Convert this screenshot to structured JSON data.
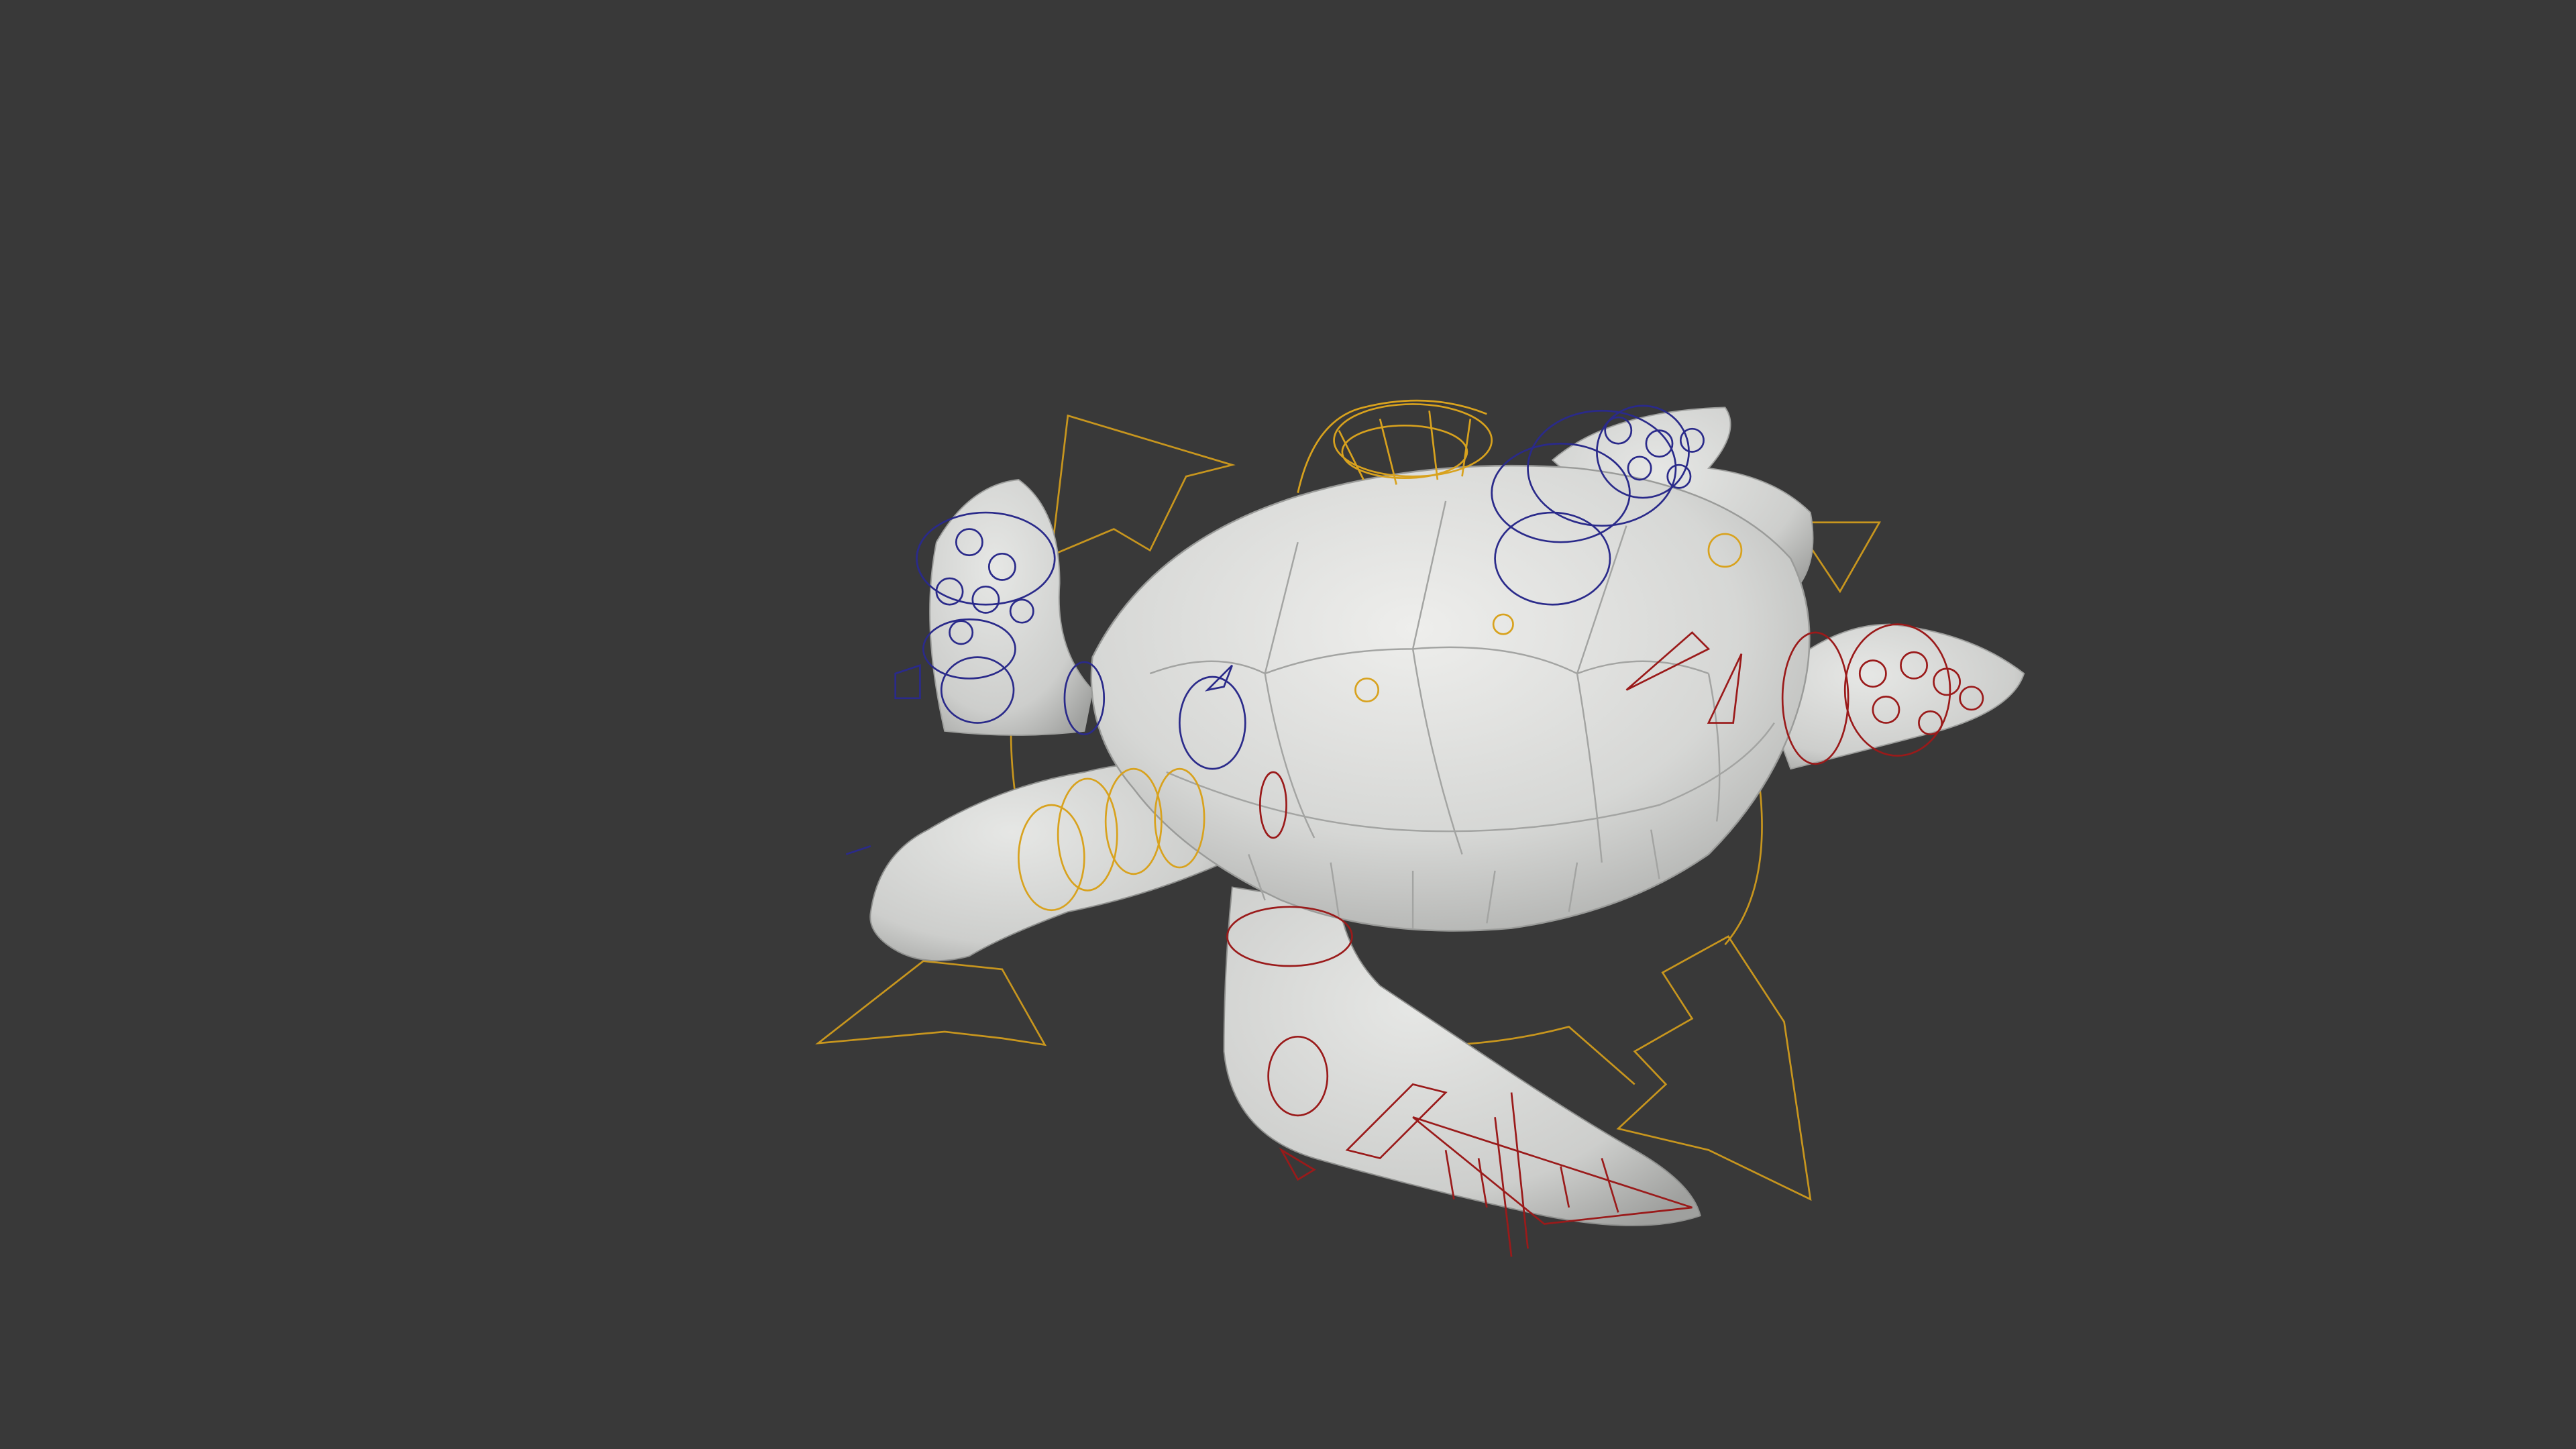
{
  "viewport": {
    "background": "#393939",
    "model": "sea-turtle",
    "shading": "solid-clay",
    "model_color": "#d9dad8"
  },
  "rig_colors": {
    "left_side": "#2a2a8a",
    "center": "#d8a21e",
    "right_side": "#9a1a1a",
    "main_control": "#c8961e"
  }
}
